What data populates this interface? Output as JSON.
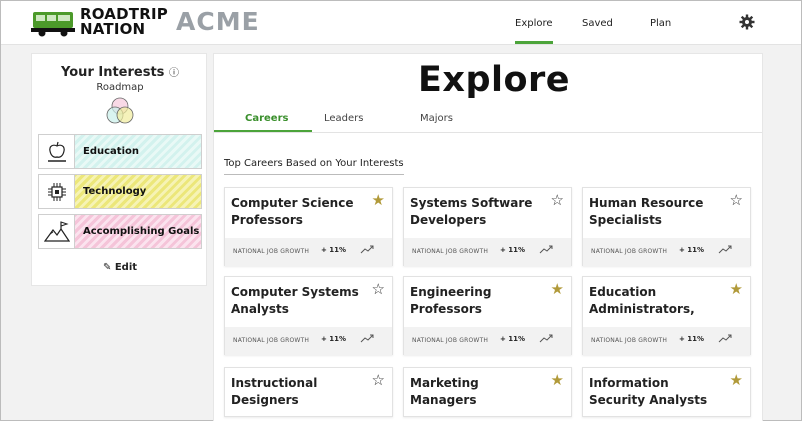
{
  "header": {
    "logo_text_line1": "ROADTRIP",
    "logo_text_line2": "NATION",
    "partner_logo": "ACME",
    "nav": [
      {
        "label": "Explore",
        "active": true
      },
      {
        "label": "Saved",
        "active": false
      },
      {
        "label": "Plan",
        "active": false
      }
    ],
    "settings_icon": "gear-icon"
  },
  "sidebar": {
    "title": "Your Interests",
    "info_icon": "ⓘ",
    "subtitle": "Roadmap",
    "interests": [
      {
        "label": "Education",
        "icon": "apple-icon",
        "color": "#d3f2ee"
      },
      {
        "label": "Technology",
        "icon": "chip-icon",
        "color": "#ece77a"
      },
      {
        "label": "Accomplishing Goals",
        "icon": "mountain-flag-icon",
        "color": "#f5c4d9"
      }
    ],
    "edit_label": "Edit"
  },
  "main": {
    "title": "Explore",
    "tabs": [
      {
        "label": "Careers",
        "active": true
      },
      {
        "label": "Leaders",
        "active": false
      },
      {
        "label": "Majors",
        "active": false
      }
    ],
    "section_heading": "Top Careers Based on Your Interests",
    "growth_label": "NATIONAL JOB GROWTH",
    "cards": [
      {
        "title": "Computer Science Professors",
        "starred": true,
        "growth": "+ 11%"
      },
      {
        "title": "Systems Software Developers",
        "starred": false,
        "growth": "+ 11%"
      },
      {
        "title": "Human Resource Specialists",
        "starred": false,
        "growth": "+ 11%"
      },
      {
        "title": "Computer Systems Analysts",
        "starred": false,
        "growth": "+ 11%"
      },
      {
        "title": "Engineering Professors",
        "starred": true,
        "growth": "+ 11%"
      },
      {
        "title": "Education Administrators,",
        "starred": true,
        "growth": "+ 11%"
      },
      {
        "title": "Instructional Designers",
        "starred": false
      },
      {
        "title": "Marketing Managers",
        "starred": true
      },
      {
        "title": "Information Security Analysts",
        "starred": true
      }
    ]
  },
  "colors": {
    "accent_green": "#4ca43a",
    "star_gold": "#b19a3a"
  }
}
